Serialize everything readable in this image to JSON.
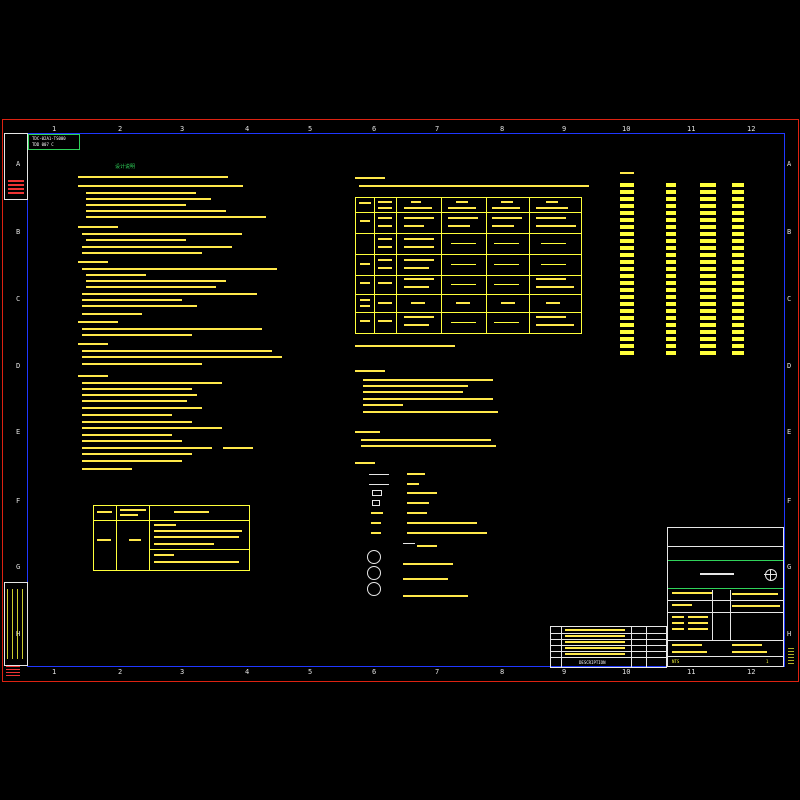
{
  "frame": {
    "top_numbers": [
      "1",
      "2",
      "3",
      "4",
      "5",
      "6",
      "7",
      "8",
      "9",
      "10",
      "11",
      "12"
    ],
    "bottom_numbers": [
      "1",
      "2",
      "3",
      "4",
      "5",
      "6",
      "7",
      "8",
      "9",
      "10",
      "11",
      "12"
    ],
    "left_letters": [
      "A",
      "B",
      "C",
      "D",
      "E",
      "F",
      "G",
      "H"
    ],
    "right_letters": [
      "A",
      "B",
      "C",
      "D",
      "E",
      "F",
      "G",
      "H"
    ]
  },
  "tag_top_left": {
    "line1": "TDC-02A1-TS000",
    "line2": "TDD 007 C"
  },
  "title_left": "设计说明",
  "table_header_right": "DESCRIPTION",
  "title_block": {
    "scale": "NTS",
    "rev": "1"
  },
  "colors": {
    "frame_red": "#dd2211",
    "frame_blue": "#2038ff",
    "text_yellow": "#ffff3a",
    "line_green": "#2fd25a"
  }
}
